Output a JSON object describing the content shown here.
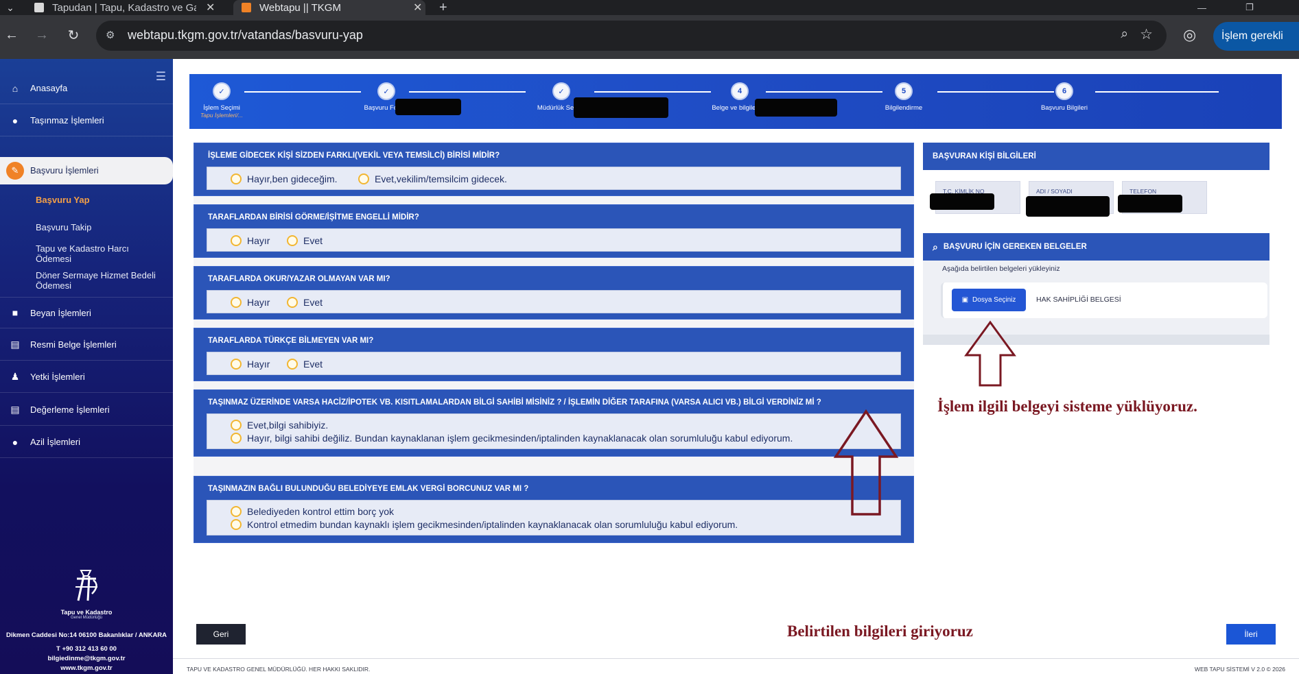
{
  "browser": {
    "tabs": [
      {
        "title": "Tapudan | Tapu, Kadastro ve Ga",
        "active": false
      },
      {
        "title": "Webtapu || TKGM",
        "active": true
      }
    ],
    "new_tab_symbol": "+",
    "url": "webtapu.tkgm.gov.tr/vatandas/basvuru-yap",
    "action_label": "İşlem gerekli"
  },
  "sidebar": {
    "items": [
      {
        "label": "Anasayfa",
        "icon": "home-icon"
      },
      {
        "label": "Taşınmaz İşlemleri",
        "icon": "map-pin-icon"
      },
      {
        "label": "Başvuru İşlemleri",
        "icon": "pen-icon",
        "active": true
      },
      {
        "label": "Beyan İşlemleri",
        "icon": "lock-icon"
      },
      {
        "label": "Resmi Belge İşlemleri",
        "icon": "document-icon"
      },
      {
        "label": "Yetki İşlemleri",
        "icon": "person-icon"
      },
      {
        "label": "Değerleme İşlemleri",
        "icon": "document-icon"
      },
      {
        "label": "Azil İşlemleri",
        "icon": "map-pin-icon"
      }
    ],
    "subitems": [
      {
        "label": "Başvuru Yap",
        "active": true
      },
      {
        "label": "Başvuru Takip"
      },
      {
        "label": "Tapu ve Kadastro Harcı Ödemesi"
      },
      {
        "label": "Döner Sermaye Hizmet Bedeli Ödemesi"
      }
    ],
    "footer": {
      "logo_title": "Tapu ve Kadastro",
      "logo_subtitle": "Genel Müdürlüğü",
      "address": "Dikmen Caddesi No:14 06100 Bakanlıklar / ANKARA",
      "phone": "T +90 312 413 60 00",
      "email": "bilgiedinme@tkgm.gov.tr",
      "website": "www.tkgm.gov.tr"
    }
  },
  "stepper": {
    "steps": [
      {
        "marker": "✓",
        "label": "İşlem Seçimi",
        "sub": "Tapu İşlemleri/..."
      },
      {
        "marker": "✓",
        "label": "Başvuru Formu",
        "sub": ""
      },
      {
        "marker": "✓",
        "label": "Müdürlük Seçimi",
        "sub": ""
      },
      {
        "marker": "4",
        "label": "Belge ve bilgileriniz",
        "sub": ""
      },
      {
        "marker": "5",
        "label": "Bilgilendirme",
        "sub": ""
      },
      {
        "marker": "6",
        "label": "Başvuru Bilgileri",
        "sub": ""
      }
    ]
  },
  "questions": [
    {
      "title": "İŞLEME GİDECEK KİŞİ SİZDEN FARKLI(VEKİL VEYA TEMSİLCİ) BİRİSİ MİDİR?",
      "options": [
        "Hayır,ben gideceğim.",
        "Evet,vekilim/temsilcim gidecek."
      ]
    },
    {
      "title": "TARAFLARDAN BİRİSİ GÖRME/İŞİTME ENGELLİ MİDİR?",
      "options": [
        "Hayır",
        "Evet"
      ]
    },
    {
      "title": "TARAFLARDA OKUR/YAZAR OLMAYAN VAR MI?",
      "options": [
        "Hayır",
        "Evet"
      ]
    },
    {
      "title": "TARAFLARDA TÜRKÇE BİLMEYEN VAR MI?",
      "options": [
        "Hayır",
        "Evet"
      ]
    },
    {
      "title": "TAŞINMAZ ÜZERİNDE VARSA HACİZ/İPOTEK VB. KISITLAMALARDAN BİLGİ SAHİBİ MİSİNİZ ? / İŞLEMİN DİĞER TARAFINA (VARSA ALICI VB.) BİLGİ VERDİNİZ Mİ ?",
      "options": [
        "Evet,bilgi sahibiyiz.",
        "Hayır, bilgi sahibi değiliz. Bundan kaynaklanan işlem gecikmesinden/iptalinden kaynaklanacak olan sorumluluğu kabul ediyorum."
      ]
    },
    {
      "title": "TAŞINMAZIN BAĞLI BULUNDUĞU BELEDİYEYE EMLAK VERGİ BORCUNUZ VAR MI ?",
      "options": [
        "Belediyeden kontrol ettim borç yok",
        "Kontrol etmedim bundan kaynaklı işlem gecikmesinden/iptalinden kaynaklanacak olan sorumluluğu kabul ediyorum."
      ]
    }
  ],
  "applicant": {
    "title": "BAŞVURAN KİŞİ BİLGİLERİ",
    "fields": [
      {
        "label": "T.C. KİMLİK NO"
      },
      {
        "label": "ADI / SOYADI"
      },
      {
        "label": "TELEFON"
      }
    ]
  },
  "documents": {
    "title": "BAŞVURU İÇİN GEREKEN BELGELER",
    "intro": "Aşağıda belirtilen belgeleri yükleyiniz",
    "upload_label": "Dosya Seçiniz",
    "document_name": "HAK SAHİPLİĞİ BELGESİ"
  },
  "annotations": {
    "upload_note": "İşlem ilgili belgeyi sisteme yüklüyoruz.",
    "form_note": "Belirtilen bilgileri giriyoruz"
  },
  "buttons": {
    "back": "Geri",
    "next": "İleri"
  },
  "footer": {
    "copyright": "TAPU VE KADASTRO GENEL MÜDÜRLÜĞÜ. HER HAKKI SAKLIDIR.",
    "version": "WEB TAPU SİSTEMİ V 2.0 © 2026"
  },
  "colors": {
    "primary_blue": "#2b55b8",
    "sidebar_dark": "#140d58",
    "accent_orange": "#f08226",
    "annotation_red": "#7a1822"
  }
}
